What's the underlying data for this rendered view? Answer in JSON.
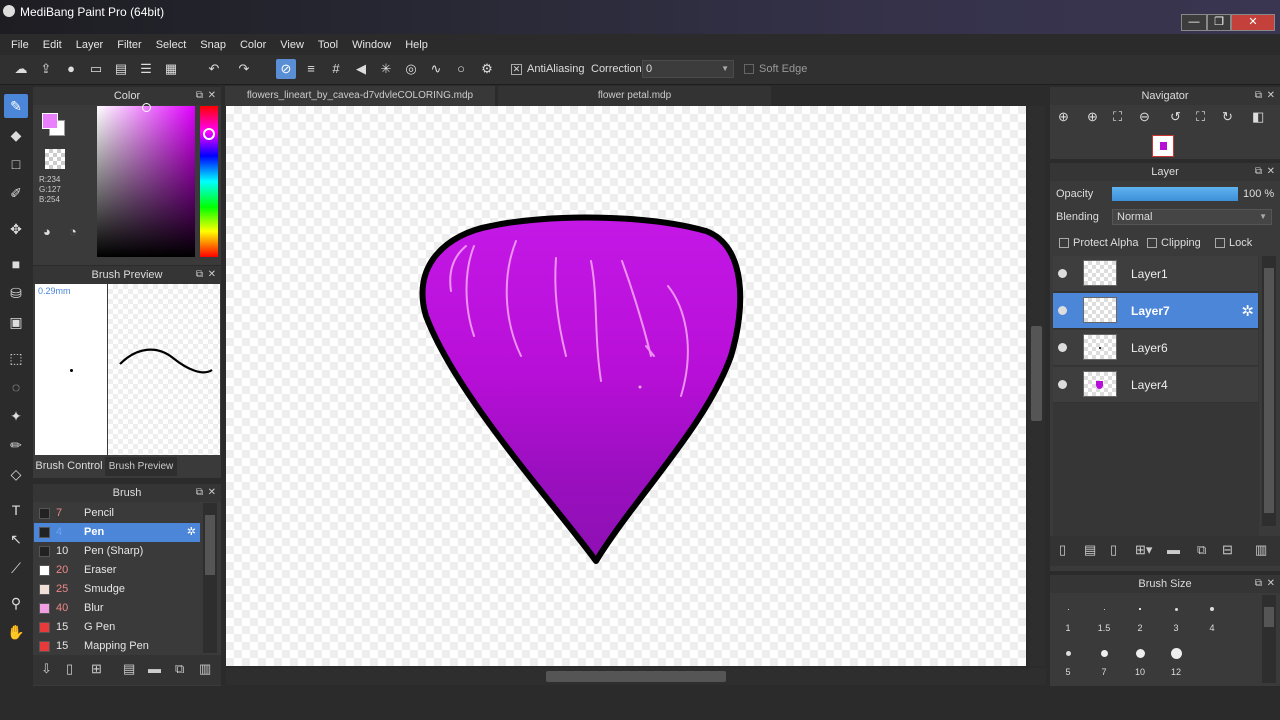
{
  "window": {
    "title": "MediBang Paint Pro (64bit)",
    "min": "—",
    "max": "❐",
    "close": "✕"
  },
  "menu": [
    "File",
    "Edit",
    "Layer",
    "Filter",
    "Select",
    "Snap",
    "Color",
    "View",
    "Tool",
    "Window",
    "Help"
  ],
  "toolbar": {
    "antialiasing_label": "AntiAliasing",
    "correction_label": "Correction",
    "correction_value": "0",
    "soft_edge_label": "Soft Edge"
  },
  "color_panel": {
    "title": "Color",
    "rgb_r": "R:234",
    "rgb_g": "G:127",
    "rgb_b": "B:254",
    "primary_color": "#ea7ffe"
  },
  "brush_preview": {
    "title": "Brush Preview",
    "size": "0.29mm",
    "tab_control": "Brush Control",
    "tab_preview": "Brush Preview"
  },
  "brush_panel": {
    "title": "Brush",
    "items": [
      {
        "size": "7",
        "name": "Pencil",
        "color": "#222222"
      },
      {
        "size": "4",
        "name": "Pen",
        "color": "#222222"
      },
      {
        "size": "10",
        "name": "Pen (Sharp)",
        "color": "#222222"
      },
      {
        "size": "20",
        "name": "Eraser",
        "color": "#ffffff"
      },
      {
        "size": "25",
        "name": "Smudge",
        "color": "#f0e0d8"
      },
      {
        "size": "40",
        "name": "Blur",
        "color": "#f0a0e0"
      },
      {
        "size": "15",
        "name": "G Pen",
        "color": "#e83a3a"
      },
      {
        "size": "15",
        "name": "Mapping Pen",
        "color": "#e83a3a"
      }
    ]
  },
  "canvas_tabs": [
    "flowers_lineart_by_cavea-d7vdvleCOLORING.mdp",
    "flower petal.mdp"
  ],
  "navigator": {
    "title": "Navigator"
  },
  "layer_panel": {
    "title": "Layer",
    "opacity_label": "Opacity",
    "opacity_value": "100 %",
    "opacity_fraction": 1.0,
    "blending_label": "Blending",
    "blending_value": "Normal",
    "protect_alpha": "Protect Alpha",
    "clipping": "Clipping",
    "lock": "Lock",
    "layers": [
      "Layer1",
      "Layer7",
      "Layer6",
      "Layer4"
    ]
  },
  "brush_size": {
    "title": "Brush Size",
    "sizes": [
      "1",
      "1.5",
      "2",
      "3",
      "4",
      "5",
      "7",
      "10",
      "12"
    ]
  }
}
